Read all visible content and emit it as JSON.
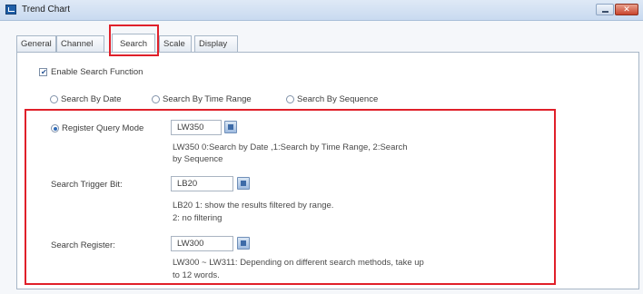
{
  "window": {
    "title": "Trend Chart",
    "close_glyph": "✕"
  },
  "tabs": [
    {
      "label": "General",
      "active": false
    },
    {
      "label": "Channel",
      "active": false
    },
    {
      "label": "Search",
      "active": true
    },
    {
      "label": "Scale",
      "active": false
    },
    {
      "label": "Display",
      "active": false
    }
  ],
  "search": {
    "enable_label": "Enable Search Function",
    "enable_checked": true,
    "modes": [
      {
        "label": "Search By Date",
        "selected": false
      },
      {
        "label": "Search By Time Range",
        "selected": false
      },
      {
        "label": "Search By Sequence",
        "selected": false
      }
    ],
    "register_query": {
      "label": "Register Query Mode",
      "selected": true,
      "value": "LW350",
      "desc_line1": "LW350 0:Search by Date ,1:Search by Time Range, 2:Search",
      "desc_line2": "by Sequence"
    },
    "trigger_bit": {
      "label": "Search Trigger Bit:",
      "value": "LB20",
      "desc_line1": "LB20 1: show the results filtered by range.",
      "desc_line2": "2: no filtering"
    },
    "search_register": {
      "label": "Search Register:",
      "value": "LW300",
      "desc_line1": "LW300 ~ LW311: Depending on different search methods, take up",
      "desc_line2": "to 12 words."
    }
  },
  "colors": {
    "highlight": "#e0202a",
    "accent": "#2f6bb8"
  },
  "icons": [
    "app-icon",
    "minimize-icon",
    "close-icon",
    "address-picker-icon"
  ]
}
